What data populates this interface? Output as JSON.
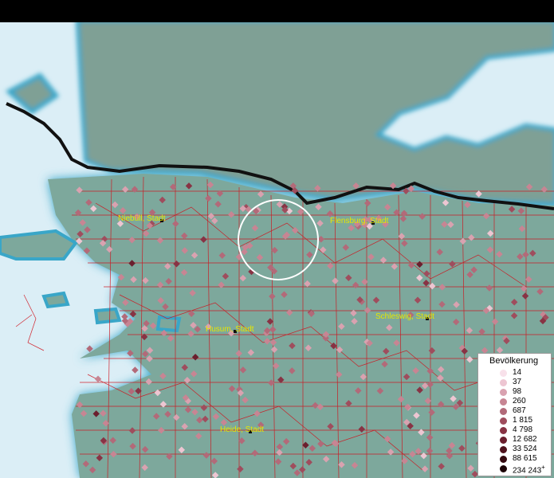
{
  "map": {
    "cities": [
      {
        "name": "Niebüll, Stadt"
      },
      {
        "name": "Flensburg, Stadt"
      },
      {
        "name": "Schleswig, Stadt"
      },
      {
        "name": "Husum, Stadt"
      },
      {
        "name": "Heide, Stadt"
      }
    ]
  },
  "legend": {
    "title": "Bevölkerung",
    "items": [
      {
        "label": "14",
        "color": "#f8e1ea"
      },
      {
        "label": "37",
        "color": "#edc6d2"
      },
      {
        "label": "98",
        "color": "#d9a2b0"
      },
      {
        "label": "260",
        "color": "#c78593"
      },
      {
        "label": "687",
        "color": "#b26a79"
      },
      {
        "label": "1 815",
        "color": "#9f4d5d"
      },
      {
        "label": "4 798",
        "color": "#883344"
      },
      {
        "label": "12 682",
        "color": "#6b1f2e"
      },
      {
        "label": "33 524",
        "color": "#4f121d"
      },
      {
        "label": "88 615",
        "color": "#350a10"
      },
      {
        "label": "234 243",
        "suffix": "+",
        "color": "#1c0306"
      }
    ]
  },
  "colors": {
    "water": "#d9ecf5",
    "land_germany": "#7da89c",
    "land_denmark": "#7fa095",
    "borders": "#d0101a",
    "city_label": "#e6e600"
  }
}
